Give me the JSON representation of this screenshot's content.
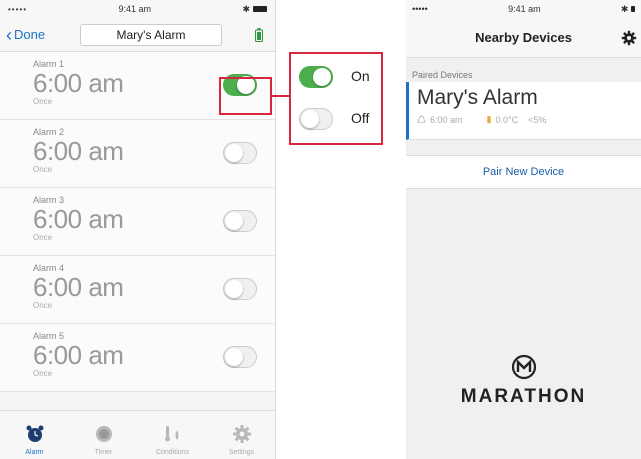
{
  "left_phone": {
    "status": {
      "signal": "•••••",
      "time": "9:41 am",
      "bt": "✱"
    },
    "nav": {
      "back_label": "Done",
      "title": "Mary's Alarm"
    },
    "alarms": [
      {
        "name": "Alarm 1",
        "time": "6:00 am",
        "repeat": "Once",
        "enabled": true
      },
      {
        "name": "Alarm 2",
        "time": "6:00 am",
        "repeat": "Once",
        "enabled": false
      },
      {
        "name": "Alarm 3",
        "time": "6:00 am",
        "repeat": "Once",
        "enabled": false
      },
      {
        "name": "Alarm 4",
        "time": "6:00 am",
        "repeat": "Once",
        "enabled": false
      },
      {
        "name": "Alarm 5",
        "time": "6:00 am",
        "repeat": "Once",
        "enabled": false
      }
    ],
    "tabs": [
      {
        "label": "Alarm",
        "icon": "alarm-clock-icon",
        "active": true
      },
      {
        "label": "Timer",
        "icon": "timer-icon",
        "active": false
      },
      {
        "label": "Conditions",
        "icon": "conditions-icon",
        "active": false
      },
      {
        "label": "Settings",
        "icon": "gear-icon",
        "active": false
      }
    ]
  },
  "callout": {
    "on_label": "On",
    "off_label": "Off"
  },
  "right_phone": {
    "status": {
      "signal": "•••••",
      "time": "9:41 am",
      "bt": "✱"
    },
    "nav": {
      "title": "Nearby Devices"
    },
    "section_header": "Paired Devices",
    "device": {
      "name": "Mary's Alarm",
      "alarm_time": "6:00 am",
      "temperature": "0.0°C",
      "humidity": "<5%"
    },
    "pair_button": "Pair New Device",
    "brand": "MARATHON"
  },
  "colors": {
    "accent": "#1a73c9",
    "toggle_on": "#4cae4c",
    "highlight": "#d8263e"
  }
}
